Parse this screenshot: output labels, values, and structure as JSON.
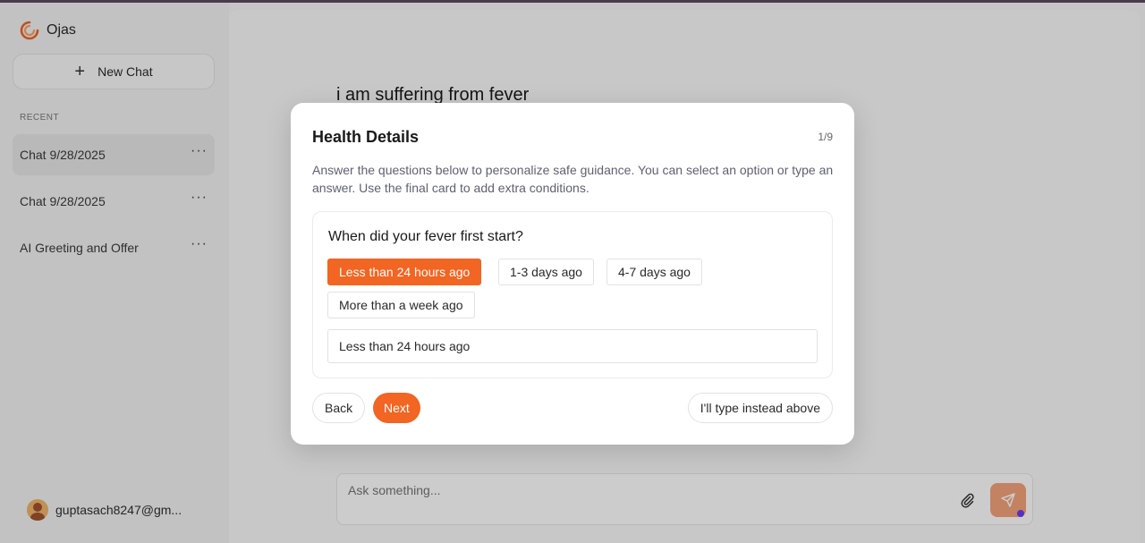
{
  "sidebar": {
    "brand": "Ojas",
    "new_chat_label": "New Chat",
    "recent_label": "RECENT",
    "chats": [
      {
        "label": "Chat 9/28/2025",
        "more": "···"
      },
      {
        "label": "Chat 9/28/2025",
        "more": "···"
      },
      {
        "label": "AI Greeting and Offer",
        "more": "···"
      }
    ],
    "user_email": "guptasach8247@gm..."
  },
  "main": {
    "user_message": "i am suffering from fever",
    "composer_placeholder": "Ask something..."
  },
  "modal": {
    "title": "Health Details",
    "step": "1/9",
    "description": "Answer the questions below to personalize safe guidance. You can select an option or type an answer. Use the final card to add extra conditions.",
    "question": "When did your fever first start?",
    "options": [
      "Less than 24 hours ago",
      "1-3 days ago",
      "4-7 days ago",
      "More than a week ago"
    ],
    "answer_value": "Less than 24 hours ago",
    "back_label": "Back",
    "next_label": "Next",
    "type_instead_label": "I'll type instead above"
  },
  "colors": {
    "accent": "#f26522",
    "send_button": "#f4a37a",
    "overlay": "rgba(0,0,0,0.2)"
  },
  "icons": {
    "brand": "swirl-logo-icon",
    "new_chat": "plus-icon",
    "chat_more": "more-dots-icon",
    "avatar": "avatar-icon",
    "attach": "paperclip-icon",
    "send": "send-icon"
  }
}
